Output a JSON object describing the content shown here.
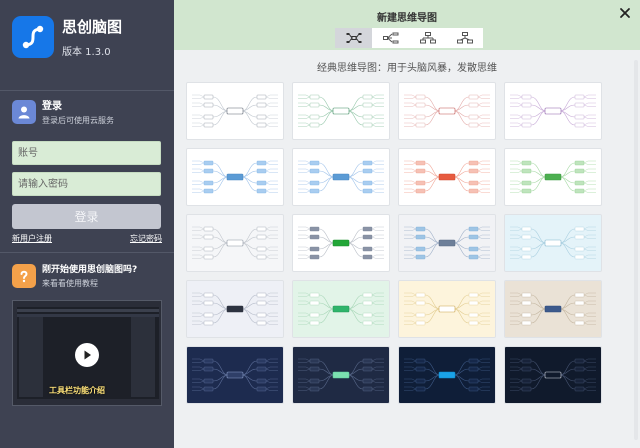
{
  "app": {
    "name": "思创脑图",
    "version": "版本 1.3.0"
  },
  "login": {
    "title": "登录",
    "subtitle": "登录后可使用云服务",
    "account_placeholder": "账号",
    "password_placeholder": "请输入密码",
    "login_label": "登录",
    "register_label": "新用户注册",
    "forgot_label": "忘记密码"
  },
  "help": {
    "title": "刚开始使用思创脑图吗?",
    "subtitle": "来看看使用教程",
    "video_caption": "工具栏功能介绍"
  },
  "dialog": {
    "title": "新建思维导图",
    "subtitle": "经典思维导图：用于头脑风暴，发散思维",
    "tabs": [
      {
        "icon": "mindmap-layout-icon",
        "active": true
      },
      {
        "icon": "logic-layout-icon",
        "active": false
      },
      {
        "icon": "org-chart-layout-icon",
        "active": false
      },
      {
        "icon": "tree-layout-icon",
        "active": false
      }
    ]
  },
  "icons": {
    "close": "close-icon",
    "play": "play-icon",
    "help": "question-icon",
    "user": "user-icon"
  },
  "colors": {
    "sidebar": "#3e4252",
    "header": "#d1e6cf",
    "brand": "#1677e8",
    "help": "#f4a14a",
    "field": "#d9ecd6"
  },
  "templates": [
    {
      "bg": "#ffffff",
      "line": "#bfc6ce",
      "center_bg": "#ffffff",
      "center_border": "#5a6270",
      "node_bg": "#ffffff",
      "node_border": "#8a93a0"
    },
    {
      "bg": "#ffffff",
      "line": "#93c6a8",
      "center_bg": "#ffffff",
      "center_border": "#3d8a60",
      "node_bg": "#ffffff",
      "node_border": "#8bbf9f"
    },
    {
      "bg": "#ffffff",
      "line": "#e3aaa8",
      "center_bg": "#ffffff",
      "center_border": "#c0504d",
      "node_bg": "#ffffff",
      "node_border": "#dba3a1"
    },
    {
      "bg": "#ffffff",
      "line": "#c6a8d6",
      "center_bg": "#ffffff",
      "center_border": "#8a5aa8",
      "node_bg": "#ffffff",
      "node_border": "#bda2cd"
    },
    {
      "bg": "#ffffff",
      "line": "#9ec2ea",
      "center_bg": "#5b9bd5",
      "center_border": "#4a88c2",
      "node_bg": "#a9cdf0",
      "node_border": "#7fb2e3"
    },
    {
      "bg": "#ffffff",
      "line": "#9ec2ea",
      "center_bg": "#5b9bd5",
      "center_border": "#4a88c2",
      "node_bg": "#a9cdf0",
      "node_border": "#7fb2e3"
    },
    {
      "bg": "#ffffff",
      "line": "#f1a596",
      "center_bg": "#e75b3f",
      "center_border": "#cf4a31",
      "node_bg": "#f6c1b5",
      "node_border": "#ec9e8c"
    },
    {
      "bg": "#ffffff",
      "line": "#a4d8a2",
      "center_bg": "#4caf50",
      "center_border": "#3e9a42",
      "node_bg": "#bfe4bd",
      "node_border": "#95cf92"
    },
    {
      "bg": "#f5f6f8",
      "line": "#c0c5cc",
      "center_bg": "#ffffff",
      "center_border": "#8a93a0",
      "node_bg": "#ffffff",
      "node_border": "#9aa2ad"
    },
    {
      "bg": "#ffffff",
      "line": "#b8bdc6",
      "center_bg": "#22a637",
      "center_border": "#1d8f2f",
      "node_bg": "#8a93a6",
      "node_border": "#7a8397"
    },
    {
      "bg": "#f1f2f5",
      "line": "#9fb0c8",
      "center_bg": "#6d7f99",
      "center_border": "#5b6c85",
      "node_bg": "#9ec5e5",
      "node_border": "#7eaed6"
    },
    {
      "bg": "#e4f3f9",
      "line": "#a9cfe0",
      "center_bg": "#ffffff",
      "center_border": "#7fb5cd",
      "node_bg": "#ffffff",
      "node_border": "#a9cfe0"
    },
    {
      "bg": "#eef0f6",
      "line": "#b4bac8",
      "center_bg": "#2d3340",
      "center_border": "#2d3340",
      "node_bg": "#ffffff",
      "node_border": "#9aa2b3"
    },
    {
      "bg": "#e2f4e8",
      "line": "#a6d6b6",
      "center_bg": "#2fb46b",
      "center_border": "#26985a",
      "node_bg": "#ffffff",
      "node_border": "#a6d6b6"
    },
    {
      "bg": "#fdf4dc",
      "line": "#e2cc8f",
      "center_bg": "#ffffff",
      "center_border": "#c9a24b",
      "node_bg": "#ffffff",
      "node_border": "#e2cc8f"
    },
    {
      "bg": "#eae2d6",
      "line": "#c2b49e",
      "center_bg": "#3d5a8c",
      "center_border": "#2e4a7a",
      "node_bg": "#ffffff",
      "node_border": "#c2b49e"
    },
    {
      "bg": "#1d2b4f",
      "line": "#5d6f9a",
      "center_bg": "#2f3f68",
      "center_border": "#8ea0cc",
      "node_bg": "#2a3a62",
      "node_border": "#5d6f9a"
    },
    {
      "bg": "#1f2a44",
      "line": "#5a6a8c",
      "center_bg": "#7be0b0",
      "center_border": "#5fcf9b",
      "node_bg": "#2b3856",
      "node_border": "#5a6a8c"
    },
    {
      "bg": "#0f1e38",
      "line": "#3f5b88",
      "center_bg": "#1aa3e8",
      "center_border": "#0f8bd0",
      "node_bg": "#16284a",
      "node_border": "#3f5b88"
    },
    {
      "bg": "#101a2c",
      "line": "#475573",
      "center_bg": "#101a2c",
      "center_border": "#d8dde8",
      "node_bg": "#18233a",
      "node_border": "#475573"
    }
  ]
}
